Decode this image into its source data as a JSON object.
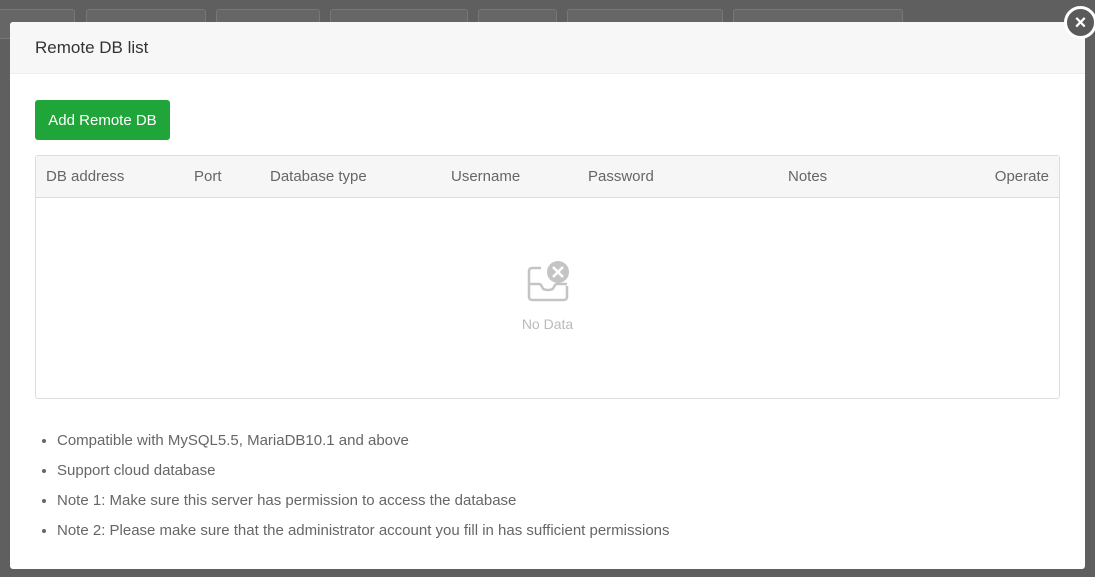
{
  "dialog": {
    "title": "Remote DB list",
    "close_label": "×",
    "add_button": "Add Remote DB"
  },
  "table": {
    "columns": [
      "DB address",
      "Port",
      "Database type",
      "Username",
      "Password",
      "Notes",
      "Operate"
    ],
    "rows": [],
    "empty_text": "No Data"
  },
  "notes": [
    "Compatible with MySQL5.5, MariaDB10.1 and above",
    "Support cloud database",
    "Note 1: Make sure this server has permission to access the database",
    "Note 2: Please make sure that the administrator account you fill in has sufficient permissions"
  ],
  "colors": {
    "accent": "#20a53a"
  }
}
